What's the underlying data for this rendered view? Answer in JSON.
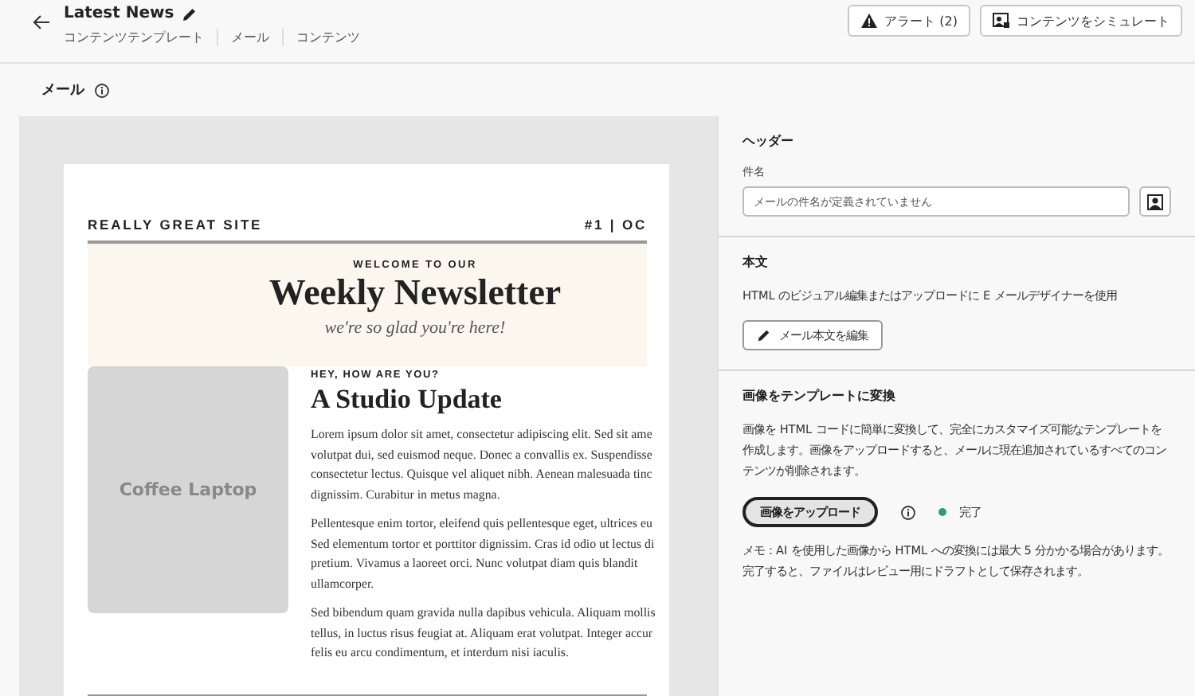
{
  "header": {
    "title": "Latest News",
    "breadcrumbs": [
      "コンテンツテンプレート",
      "メール",
      "コンテンツ"
    ],
    "buttons": [
      {
        "kind": "alert",
        "label": "アラート (2)"
      },
      {
        "kind": "simulate",
        "label": "コンテンツをシミュレート"
      }
    ]
  },
  "section_title": "メール",
  "email": {
    "site": "REALLY GREAT SITE",
    "issue": "#1 | OC",
    "welcome": "WELCOME TO OUR",
    "headline": "Weekly Newsletter",
    "tagline": "we're so glad you're here!",
    "image_label": "Coffee Laptop",
    "kicker": "HEY, HOW ARE YOU?",
    "article_title": "A Studio Update",
    "paragraphs": [
      [
        "Lorem ipsum dolor sit amet, consectetur adipiscing elit. Sed sit ame",
        "volutpat dui, sed euismod neque. Donec a convallis ex. Suspendisse",
        "consectetur lectus. Quisque vel aliquet nibh. Aenean malesuada tinc",
        "dignissim. Curabitur in metus magna."
      ],
      [
        "Pellentesque enim tortor, eleifend quis pellentesque eget, ultrices eu",
        "Sed elementum tortor et porttitor dignissim. Cras id odio ut lectus di",
        "pretium. Vivamus a laoreet orci. Nunc volutpat diam quis blandit",
        "ullamcorper."
      ],
      [
        "Sed bibendum quam gravida nulla dapibus vehicula. Aliquam mollis",
        "tellus, in luctus risus feugiat at. Aliquam erat volutpat. Integer accur",
        "felis eu arcu condimentum, et interdum nisi iaculis."
      ]
    ]
  },
  "panel": {
    "header_section": {
      "title": "ヘッダー",
      "subject_label": "件名",
      "subject_placeholder": "メールの件名が定義されていません"
    },
    "body_section": {
      "title": "本文",
      "description": "HTML のビジュアル編集またはアップロードに E メールデザイナーを使用",
      "button": "メール本文を編集"
    },
    "convert_section": {
      "title": "画像をテンプレートに変換",
      "description": "画像を HTML コードに簡単に変換して、完全にカスタマイズ可能なテンプレートを作成します。画像をアップロードすると、メールに現在追加されているすべてのコンテンツが削除されます。",
      "button": "画像をアップロード",
      "status": {
        "label": "完了",
        "color": "#2d9d78"
      },
      "note": "メモ：AI を使用した画像から HTML への変換には最大 5 分かかる場合があります。完了すると、ファイルはレビュー用にドラフトとして保存されます。"
    }
  }
}
